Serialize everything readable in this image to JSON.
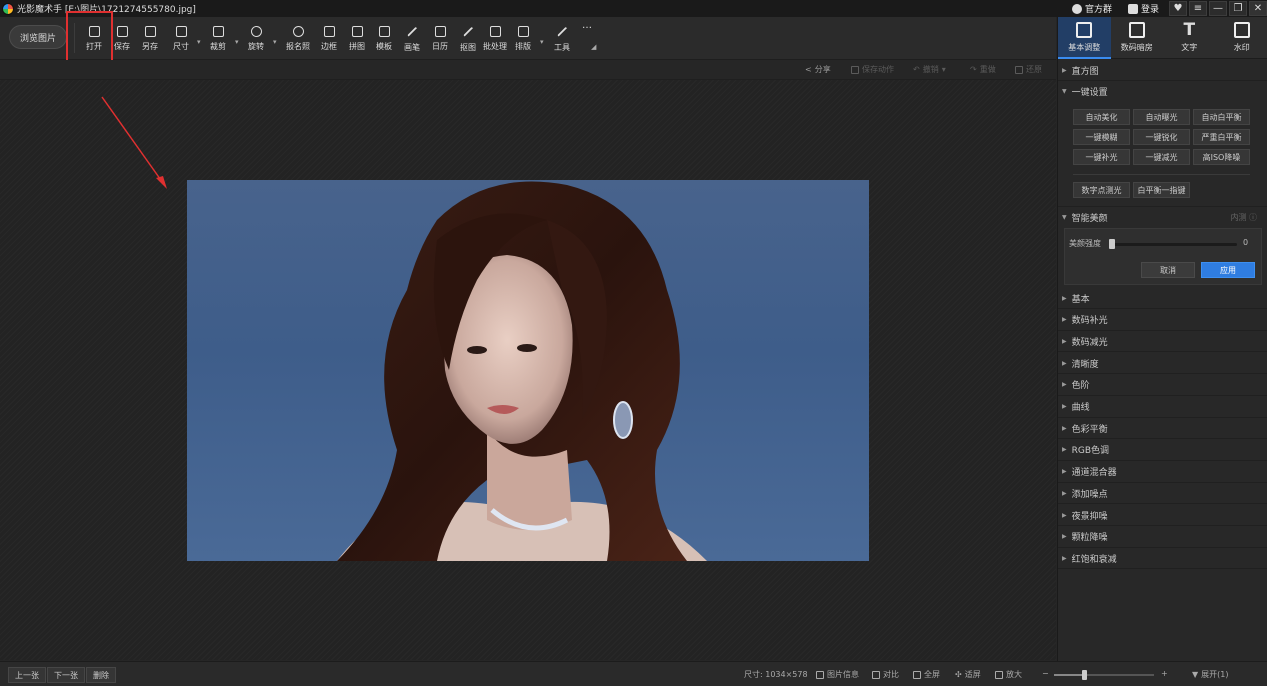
{
  "window": {
    "title": "光影魔术手 [E:\\图片\\1721274555780.jpg]",
    "official_group": "官方群",
    "login": "登录",
    "controls": [
      "♥",
      "≡",
      "—",
      "❐",
      "✕"
    ]
  },
  "toolbar": {
    "browse": "浏览图片",
    "tools": [
      {
        "label": "打开",
        "icon": "open-image-icon"
      },
      {
        "label": "保存",
        "icon": "save-icon"
      },
      {
        "label": "另存",
        "icon": "save-as-icon"
      },
      {
        "label": "尺寸",
        "icon": "resize-icon"
      },
      {
        "label": "裁剪",
        "icon": "crop-icon"
      },
      {
        "label": "旋转",
        "icon": "rotate-icon"
      },
      {
        "label": "报名照",
        "icon": "id-photo-icon"
      },
      {
        "label": "边框",
        "icon": "frame-icon"
      },
      {
        "label": "拼图",
        "icon": "collage-icon"
      },
      {
        "label": "模板",
        "icon": "template-icon"
      },
      {
        "label": "画笔",
        "icon": "brush-icon"
      },
      {
        "label": "日历",
        "icon": "calendar-icon"
      },
      {
        "label": "抠图",
        "icon": "cutout-icon"
      },
      {
        "label": "批处理",
        "icon": "batch-icon"
      },
      {
        "label": "排版",
        "icon": "layout-icon"
      },
      {
        "label": "工具",
        "icon": "wrench-icon"
      },
      {
        "label": "…",
        "icon": "more-icon"
      }
    ]
  },
  "subbar": {
    "share": "分享",
    "save_action": "保存动作",
    "undo": "撤销",
    "redo": "重做",
    "restore": "还原"
  },
  "right_panel": {
    "tabs": [
      {
        "label": "基本调整",
        "active": true
      },
      {
        "label": "数码暗房",
        "active": false
      },
      {
        "label": "文字",
        "active": false
      },
      {
        "label": "水印",
        "active": false
      }
    ],
    "histogram": "直方图",
    "one_click": "一键设置",
    "one_click_buttons": [
      "自动美化",
      "自动曝光",
      "自动白平衡",
      "一键模糊",
      "一键锐化",
      "严重白平衡",
      "一键补光",
      "一键减光",
      "高ISO降噪"
    ],
    "extra_buttons": [
      "数字点测光",
      "白平衡一指键"
    ],
    "smart_beauty": {
      "title": "智能美颜",
      "note": "内测 ⓘ",
      "slider_label": "美颜强度",
      "slider_value": "0",
      "cancel": "取消",
      "apply": "应用"
    },
    "sections": [
      "基本",
      "数码补光",
      "数码减光",
      "清晰度",
      "色阶",
      "曲线",
      "色彩平衡",
      "RGB色调",
      "通道混合器",
      "添加噪点",
      "夜景抑噪",
      "颗粒降噪",
      "红饱和衰减"
    ]
  },
  "bottom": {
    "prev": "上一张",
    "next": "下一张",
    "delete": "删除",
    "size": "尺寸: 1034×578",
    "info": "图片信息",
    "compare": "对比",
    "fullscreen": "全屏",
    "fit": "适屏",
    "zoom_in": "放大",
    "minus": "−",
    "plus": "+",
    "expand": "展开(1)",
    "zoom_level": 0.3
  },
  "colors": {
    "accent": "#2f7de1",
    "highlight": "#e03030"
  }
}
